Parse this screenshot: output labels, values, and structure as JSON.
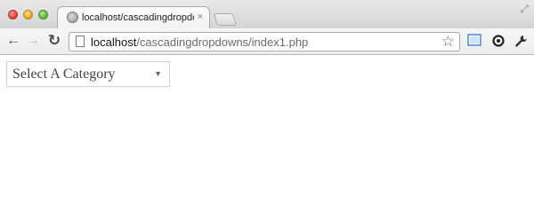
{
  "browser": {
    "tab": {
      "title": "localhost/cascadingdropdow",
      "close_glyph": "×"
    },
    "address_bar": {
      "host": "localhost",
      "path": "/cascadingdropdowns/index1.php"
    },
    "icons": {
      "back": "back-arrow-icon",
      "forward": "forward-arrow-icon",
      "reload": "reload-icon",
      "bookmark": "star-icon",
      "screen": "screen-icon",
      "sync": "sync-icon",
      "settings": "wrench-icon"
    }
  },
  "page": {
    "category_select": {
      "selected": "Select A Category"
    }
  },
  "colors": {
    "traffic_close": "#e0443a",
    "traffic_minimize": "#e6a92a",
    "traffic_maximize": "#62b73a"
  }
}
